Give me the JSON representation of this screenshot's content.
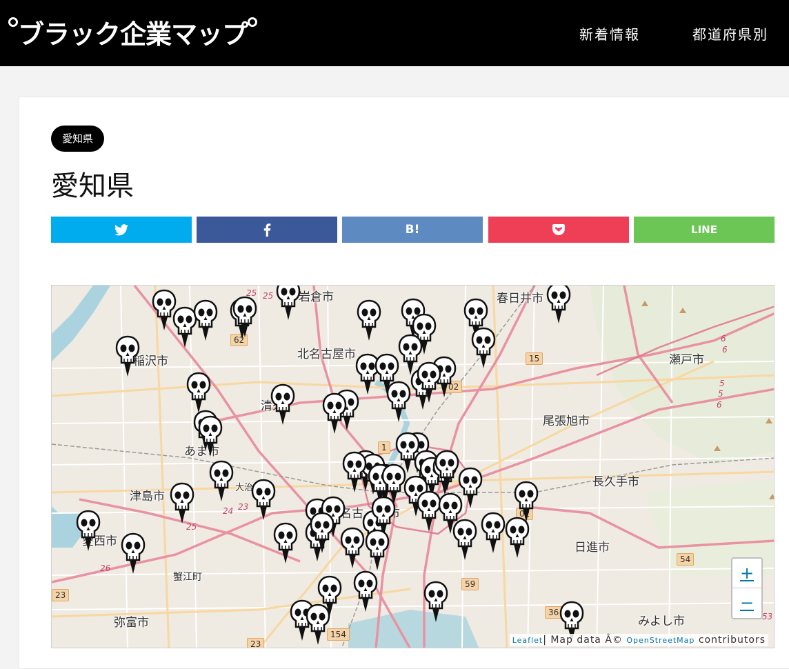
{
  "header": {
    "logo_text": "ブラック企業マップ",
    "nav": [
      "新着情報",
      "都道府県別"
    ]
  },
  "page": {
    "badge": "愛知県",
    "title": "愛知県"
  },
  "share": [
    {
      "name": "twitter",
      "label": "",
      "color": "#00acee",
      "icon": "twitter-icon"
    },
    {
      "name": "facebook",
      "label": "",
      "color": "#3b5998",
      "icon": "facebook-icon"
    },
    {
      "name": "hatena",
      "label": "B!",
      "color": "#5d8ac1",
      "icon": "hatena-icon"
    },
    {
      "name": "pocket",
      "label": "",
      "color": "#ef3f56",
      "icon": "pocket-icon"
    },
    {
      "name": "line",
      "label": "LINE",
      "color": "#6cc655",
      "icon": "line-icon"
    }
  ],
  "map": {
    "places": [
      "岩倉市",
      "春日井市",
      "北名古屋市",
      "稲沢市",
      "瀬戸市",
      "清須",
      "尾張旭市",
      "あま市",
      "長久手市",
      "津島市",
      "大治",
      "名古",
      "愛西市",
      "日進市",
      "蟹江町",
      "弥富市",
      "みよし市",
      "市"
    ],
    "shields": [
      "62",
      "15",
      "02",
      "1",
      "2",
      "02",
      "54",
      "59",
      "36",
      "154",
      "23",
      "23"
    ],
    "route_numbers": [
      "25",
      "25",
      "24",
      "23",
      "25",
      "26",
      "6",
      "6",
      "5",
      "5",
      "6",
      "53"
    ],
    "marker_icon": "skull-marker-icon",
    "marker_count": 66,
    "zoom_in": "+",
    "zoom_out": "−",
    "attribution": {
      "leaflet": "Leaflet",
      "sep": "| Map data Â© ",
      "osm": "OpenStreetMap",
      "tail": " contributors"
    }
  }
}
